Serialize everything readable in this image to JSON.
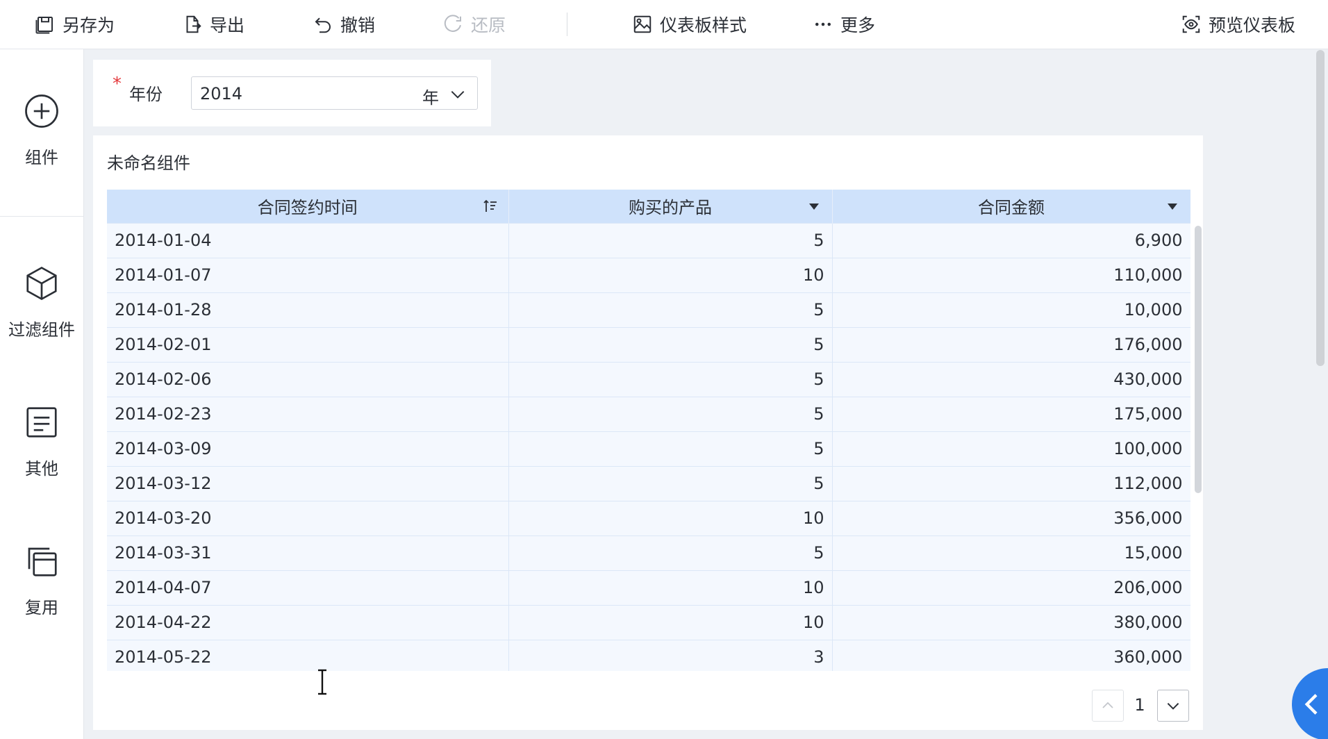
{
  "toolbar": {
    "save_as": "另存为",
    "export": "导出",
    "undo": "撤销",
    "redo": "还原",
    "dashboard_style": "仪表板样式",
    "more": "更多",
    "preview": "预览仪表板"
  },
  "sidebar": {
    "items": [
      {
        "label": "组件",
        "icon": "add-circle-icon"
      },
      {
        "label": "过滤组件",
        "icon": "cube-icon"
      },
      {
        "label": "其他",
        "icon": "document-icon"
      },
      {
        "label": "复用",
        "icon": "copy-icon"
      }
    ]
  },
  "filter": {
    "required_mark": "*",
    "label": "年份",
    "value": "2014",
    "unit": "年"
  },
  "widget": {
    "title": "未命名组件",
    "columns": [
      "合同签约时间",
      "购买的产品",
      "合同金额"
    ],
    "rows": [
      [
        "2014-01-04",
        "5",
        "6,900"
      ],
      [
        "2014-01-07",
        "10",
        "110,000"
      ],
      [
        "2014-01-28",
        "5",
        "10,000"
      ],
      [
        "2014-02-01",
        "5",
        "176,000"
      ],
      [
        "2014-02-06",
        "5",
        "430,000"
      ],
      [
        "2014-02-23",
        "5",
        "175,000"
      ],
      [
        "2014-03-09",
        "5",
        "100,000"
      ],
      [
        "2014-03-12",
        "5",
        "112,000"
      ],
      [
        "2014-03-20",
        "10",
        "356,000"
      ],
      [
        "2014-03-31",
        "5",
        "15,000"
      ],
      [
        "2014-04-07",
        "10",
        "206,000"
      ],
      [
        "2014-04-22",
        "10",
        "380,000"
      ],
      [
        "2014-05-22",
        "3",
        "360,000"
      ]
    ],
    "page": "1"
  },
  "colors": {
    "header_bg": "#cfe2fb",
    "row_bg": "#f4f8fe",
    "accent": "#2b7de9",
    "required": "#e4393c"
  }
}
